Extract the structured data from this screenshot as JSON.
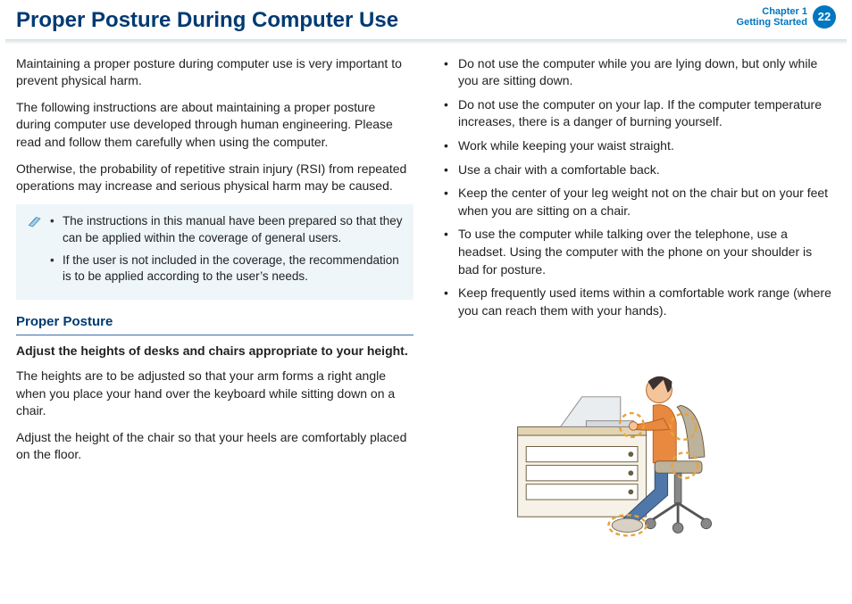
{
  "header": {
    "title": "Proper Posture During Computer Use",
    "chapter_line1": "Chapter 1",
    "chapter_line2": "Getting Started",
    "page_number": "22"
  },
  "left": {
    "p1": "Maintaining a proper posture during computer use is very important to prevent physical harm.",
    "p2": "The following instructions are about maintaining a proper posture during computer use developed through human engineering. Please read and follow them carefully when using the computer.",
    "p3": "Otherwise, the probability of repetitive strain injury (RSI) from repeated operations may increase and serious physical harm may be caused.",
    "note": {
      "items": [
        "The instructions in this manual have been prepared so that they can be applied within the coverage of general users.",
        "If the user is not included in the coverage, the recommendation is to be applied according to the user’s needs."
      ]
    },
    "section_heading": "Proper Posture",
    "sub_bold": "Adjust the heights of desks and chairs appropriate to your height.",
    "p4": "The heights are to be adjusted so that your arm forms a right angle when you place your hand over the keyboard while sitting down on a chair.",
    "p5": "Adjust the height of the chair so that your heels are comfortably placed on the floor."
  },
  "right": {
    "items": [
      "Do not use the computer while you are lying down, but only while you are sitting down.",
      "Do not use the computer on your lap. If the computer temperature increases, there is a danger of burning yourself.",
      "Work while keeping your waist straight.",
      "Use a chair with a comfortable back.",
      "Keep the center of your leg weight not on the chair but on your feet when you are sitting on a chair.",
      "To use the computer while talking over the telephone, use a headset. Using the computer with the phone on your shoulder is bad for posture.",
      "Keep frequently used items within a comfortable work range (where you can reach them with your hands)."
    ]
  }
}
